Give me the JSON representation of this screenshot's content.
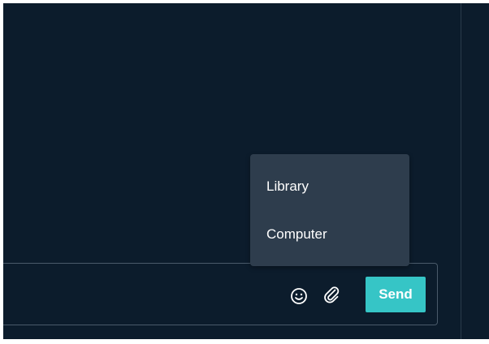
{
  "composer": {
    "send_label": "Send",
    "emoji_icon": "smiley-face-icon",
    "attach_icon": "paperclip-icon"
  },
  "attach_menu": {
    "items": [
      {
        "label": "Library"
      },
      {
        "label": "Computer"
      }
    ]
  },
  "colors": {
    "background": "#0c1c2c",
    "menu_background": "#2e3d4d",
    "accent": "#36c5c6",
    "text": "#ffffff",
    "border": "#4a5a6a"
  }
}
